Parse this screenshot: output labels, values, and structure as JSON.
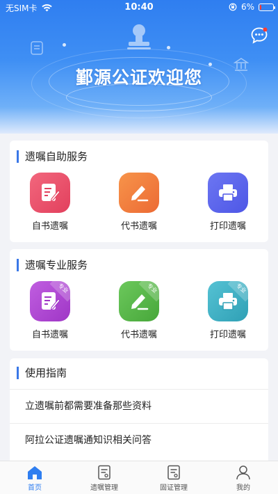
{
  "status_bar": {
    "carrier": "无SIM卡",
    "time": "10:40",
    "battery": "6%",
    "battery_level": 0.06
  },
  "banner": {
    "welcome_text": "鄞源公证欢迎您",
    "chat_icon": "chat-bubble-icon"
  },
  "self_service": {
    "title": "遗嘱自助服务",
    "items": [
      {
        "label": "自书遗嘱",
        "icon": "edit-note-icon",
        "color": "#ea4f6a"
      },
      {
        "label": "代书遗嘱",
        "icon": "pen-write-icon",
        "color": "#f0793f"
      },
      {
        "label": "打印遗嘱",
        "icon": "printer-icon",
        "color": "#5a64ec"
      }
    ]
  },
  "pro_service": {
    "title": "遗嘱专业服务",
    "badge": "专业",
    "items": [
      {
        "label": "自书遗嘱",
        "icon": "edit-note-icon",
        "color": "#b147d3"
      },
      {
        "label": "代书遗嘱",
        "icon": "pen-write-icon",
        "color": "#58b84b"
      },
      {
        "label": "打印遗嘱",
        "icon": "printer-icon",
        "color": "#3fb0c4"
      }
    ]
  },
  "guide": {
    "title": "使用指南",
    "items": [
      {
        "text": "立遗嘱前都需要准备那些资料"
      },
      {
        "text": "阿拉公证遗嘱通知识相关问答"
      }
    ]
  },
  "tabbar": {
    "active_color": "#2f7ef0",
    "tabs": [
      {
        "label": "首页",
        "icon": "home-icon"
      },
      {
        "label": "遗嘱管理",
        "icon": "document-manage-icon"
      },
      {
        "label": "固证管理",
        "icon": "certificate-manage-icon"
      },
      {
        "label": "我的",
        "icon": "user-icon"
      }
    ]
  }
}
